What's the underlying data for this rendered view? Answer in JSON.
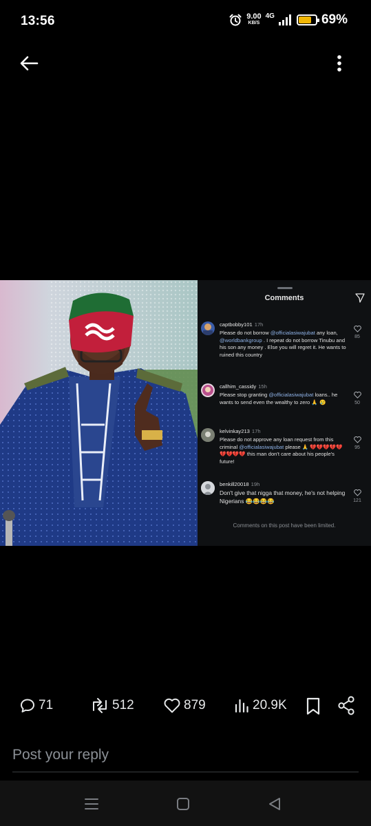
{
  "status_bar": {
    "time": "13:56",
    "net_speed": "9.00",
    "net_speed_unit": "KB/S",
    "network": "4G",
    "battery": "69%",
    "battery_level": 0.69,
    "battery_color": "#f2b705"
  },
  "top_nav": {
    "back_icon": "arrow-left-icon",
    "more_icon": "more-vertical-icon"
  },
  "comments_panel": {
    "title": "Comments",
    "footer": "Comments on this post have been limited.",
    "comments": [
      {
        "user": "captbobby101",
        "time": "17h",
        "text_parts": [
          "Please do not borrow ",
          "@officialasiwajubat",
          " any loan, ",
          "@worldbankgroup",
          " . I repeat do not borrow Tinubu and his son any money . Else you will regret it. He wants to ruined this country"
        ],
        "likes": "85"
      },
      {
        "user": "callhim_cassidy",
        "time": "15h",
        "text_parts": [
          "Please stop granting ",
          "@officialasiwajubat",
          " loans.. he wants to send even the wealthy to zero 🙏 😢"
        ],
        "likes": "50"
      },
      {
        "user": "kelvinkay213",
        "time": "17h",
        "text_parts": [
          "Please do not approve any loan request from this criminal ",
          "@officialasiwajubat",
          " please 🙏 💔💔💔💔💔💔💔💔💔 this man don't care about his people's future!"
        ],
        "likes": "95"
      },
      {
        "user": "benkill20018",
        "time": "19h",
        "text_parts": [
          "Don't give that nigga that money, he's not helping Nigerians 😂😂😂😂"
        ],
        "likes": "121"
      }
    ]
  },
  "actions": {
    "replies": "71",
    "reposts": "512",
    "likes": "879",
    "views": "20.9K",
    "bookmark_icon": "bookmark-icon",
    "share_icon": "share-icon"
  },
  "reply": {
    "placeholder": "Post your reply"
  },
  "nav_bar": {
    "menu_icon": "menu-icon",
    "home_icon": "home-square-icon",
    "back_icon": "back-triangle-icon"
  }
}
